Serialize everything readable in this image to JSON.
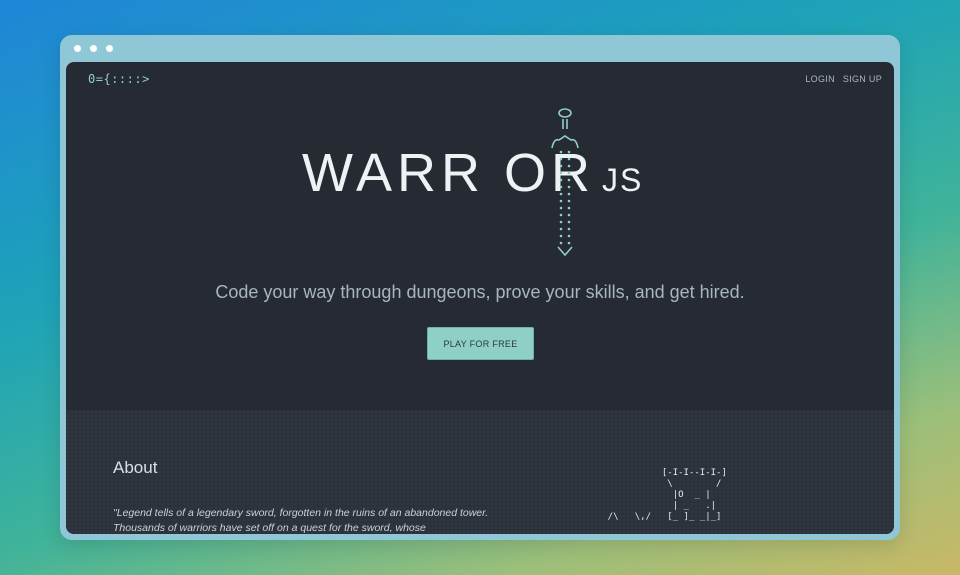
{
  "window": {},
  "header": {
    "logo": "0={::::>",
    "nav": [
      {
        "label": "LOGIN"
      },
      {
        "label": "SIGN UP"
      }
    ]
  },
  "hero": {
    "logo_left": "WARR",
    "logo_right": "OR",
    "logo_suffix": "JS",
    "tagline": "Code your way through dungeons, prove your skills, and get hired.",
    "cta_label": "PLAY FOR FREE"
  },
  "about": {
    "title": "About",
    "text": "\"Legend tells of a legendary sword, forgotten in the ruins of an abandoned tower. Thousands of warriors have set off on a quest for the sword, whose",
    "ascii_art": "              [-I-I--I-I-]\n               \\        /\n                |O  _ |\n                | _   .|\n    /\\   \\,/   [_ ]_ _|_]"
  },
  "colors": {
    "accent": "#8fd0c4",
    "background": "#252a33",
    "about_background": "#2c323b",
    "frame": "#8fc7d6"
  }
}
